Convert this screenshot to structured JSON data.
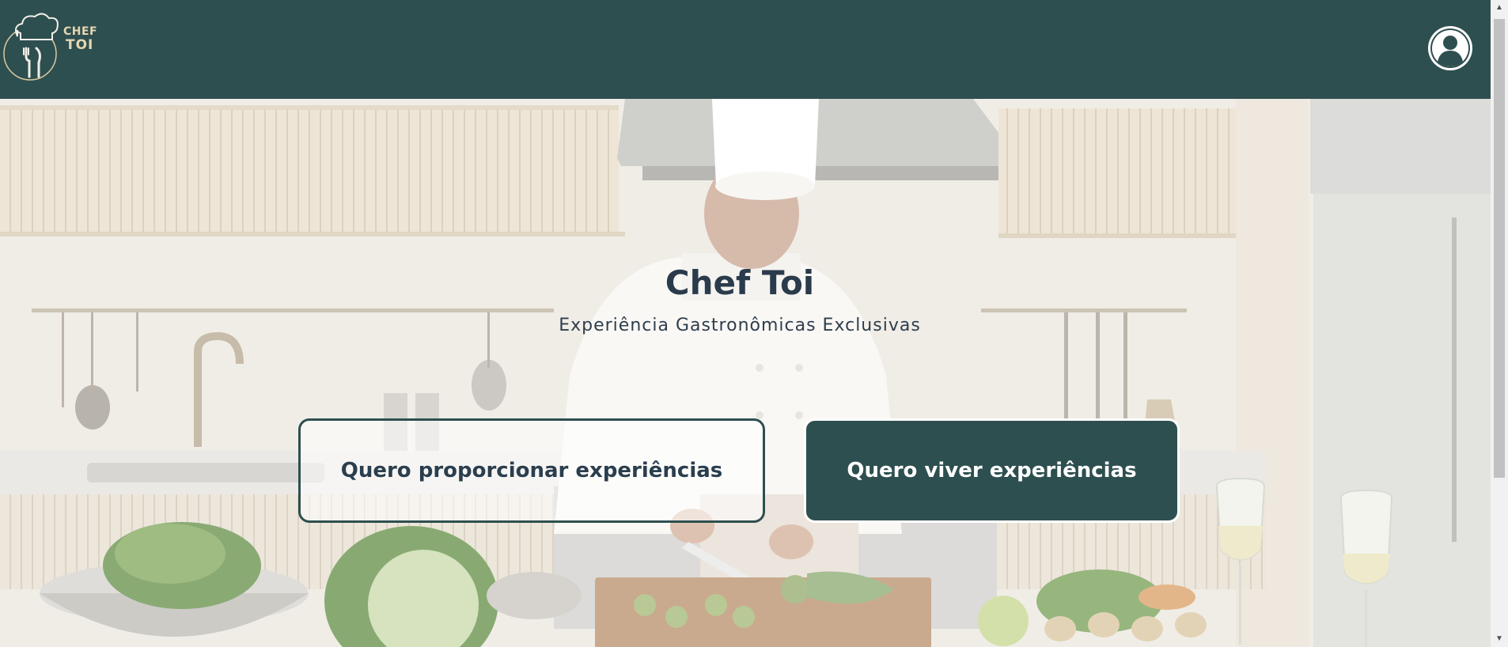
{
  "header": {
    "logo_line1": "CHEF",
    "logo_line2": "TOI",
    "profile_icon": "user-avatar-icon"
  },
  "hero": {
    "title": "Chef Toi",
    "subtitle": "Experiência Gastronômicas Exclusivas",
    "buttons": {
      "provide_label": "Quero proporcionar experiências",
      "live_label": "Quero viver experiências"
    }
  },
  "colors": {
    "header_bg": "#2e4f4f",
    "logo_gold": "#e6d6b2",
    "title_text": "#2a3b4b",
    "primary_button_bg": "#2e4f4f",
    "primary_button_text": "#ffffff"
  }
}
